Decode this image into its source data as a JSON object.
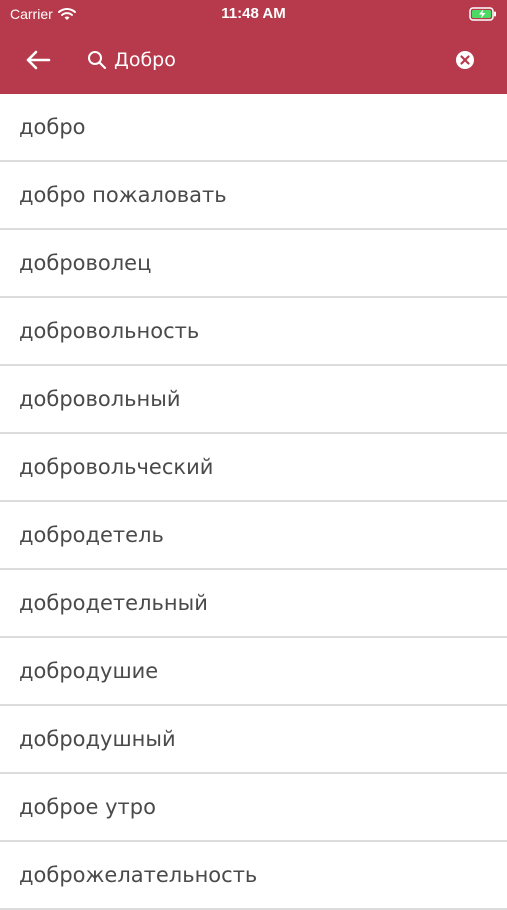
{
  "status_bar": {
    "carrier": "Carrier",
    "time": "11:48 AM"
  },
  "header": {
    "background_color": "#b63a4b",
    "search": {
      "value": "Добро"
    },
    "icons": {
      "back": "arrow-left-icon",
      "search": "magnifier-icon",
      "clear": "clear-circle-icon"
    }
  },
  "results": [
    "добро",
    "добро пожаловать",
    "доброволец",
    "добровольность",
    "добровольный",
    "добровольческий",
    "добродетель",
    "добродетельный",
    "добродушие",
    "добродушный",
    "доброе утро",
    "доброжелательность"
  ]
}
